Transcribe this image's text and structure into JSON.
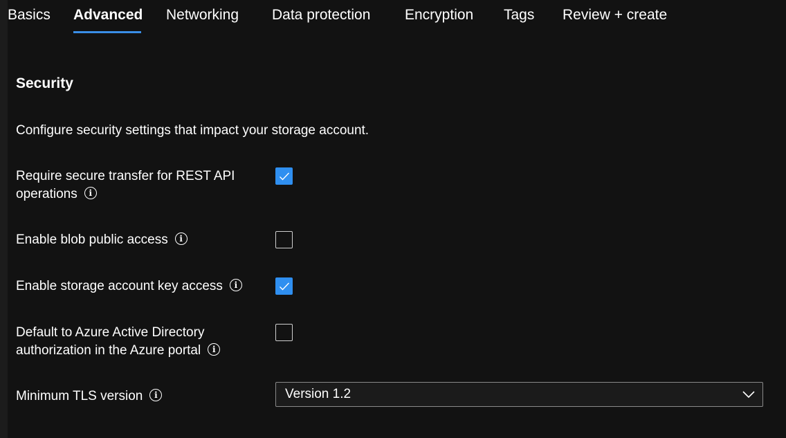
{
  "tabs": [
    {
      "label": "Basics"
    },
    {
      "label": "Advanced"
    },
    {
      "label": "Networking"
    },
    {
      "label": "Data protection"
    },
    {
      "label": "Encryption"
    },
    {
      "label": "Tags"
    },
    {
      "label": "Review + create"
    }
  ],
  "active_tab": "Advanced",
  "section": {
    "title": "Security",
    "description": "Configure security settings that impact your storage account."
  },
  "settings": {
    "secure_transfer": {
      "label": "Require secure transfer for REST API operations",
      "checked": true
    },
    "blob_public_access": {
      "label": "Enable blob public access",
      "checked": false
    },
    "key_access": {
      "label": "Enable storage account key access",
      "checked": true
    },
    "aad_default": {
      "label": "Default to Azure Active Directory authorization in the Azure portal",
      "checked": false
    },
    "min_tls": {
      "label": "Minimum TLS version",
      "value": "Version 1.2"
    }
  },
  "icons": {
    "info": "info-icon",
    "check": "checkmark-icon",
    "dropdown": "chevron-down-icon"
  },
  "colors": {
    "background": "#121212",
    "accent": "#2f8ff0",
    "tab_underline": "#3a8ee6"
  }
}
